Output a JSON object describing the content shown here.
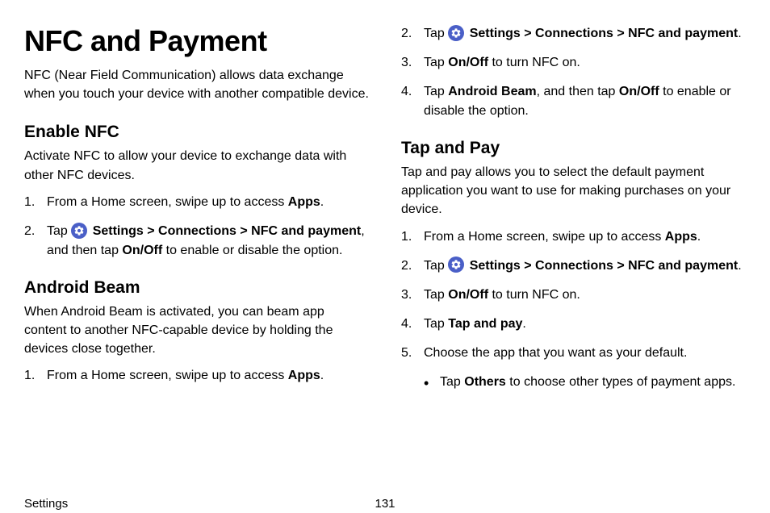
{
  "page": {
    "title": "NFC and Payment",
    "intro": "NFC (Near Field Communication) allows data exchange when you touch your device with another compatible device."
  },
  "enable_nfc": {
    "heading": "Enable NFC",
    "desc": "Activate NFC to allow your device to exchange data with other NFC devices.",
    "step1_pre": "From a Home screen, swipe up to access ",
    "step1_bold": "Apps",
    "step2_tap": "Tap ",
    "step2_settings": " Settings",
    "step2_sep1": " > ",
    "step2_conn": "Connections",
    "step2_sep2": " > ",
    "step2_nfc": "NFC and payment",
    "step2_mid": ", and then tap ",
    "step2_onoff": "On/Off",
    "step2_end": " to enable or disable the option."
  },
  "android_beam": {
    "heading": "Android Beam",
    "desc": "When Android Beam is activated, you can beam app content to another NFC-capable device by holding the devices close together.",
    "step1_pre": "From a Home screen, swipe up to access ",
    "step1_bold": "Apps",
    "step2_tap": "Tap ",
    "step2_settings": " Settings",
    "step2_sep1": " > ",
    "step2_conn": "Connections",
    "step2_sep2": " > ",
    "step2_nfc": "NFC and payment",
    "step3_tap": "Tap ",
    "step3_onoff": "On/Off",
    "step3_end": " to turn NFC on.",
    "step4_tap": "Tap ",
    "step4_ab": "Android Beam",
    "step4_mid": ", and then tap ",
    "step4_onoff": "On/Off",
    "step4_end": " to enable or disable the option."
  },
  "tap_pay": {
    "heading": "Tap and Pay",
    "desc": "Tap and pay allows you to select the default payment application you want to use for making purchases on your device.",
    "step1_pre": "From a Home screen, swipe up to access ",
    "step1_bold": "Apps",
    "step2_tap": "Tap ",
    "step2_settings": " Settings",
    "step2_sep1": " > ",
    "step2_conn": "Connections",
    "step2_sep2": " > ",
    "step2_nfc": "NFC and payment",
    "step3_tap": "Tap ",
    "step3_onoff": "On/Off",
    "step3_end": " to turn NFC on.",
    "step4_tap": "Tap ",
    "step4_tp": "Tap and pay",
    "step5": "Choose the app that you want as your default.",
    "bullet_tap": "Tap ",
    "bullet_others": "Others",
    "bullet_end": " to choose other types of payment apps."
  },
  "footer": {
    "section": "Settings",
    "page_num": "131"
  },
  "nums": {
    "n1": "1.",
    "n2": "2.",
    "n3": "3.",
    "n4": "4.",
    "n5": "5."
  },
  "period": "."
}
